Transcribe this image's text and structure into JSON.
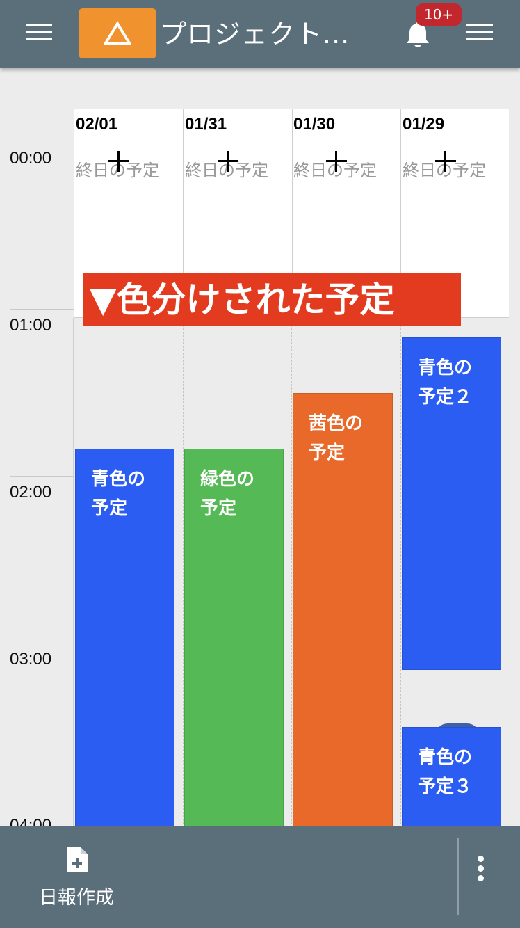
{
  "header": {
    "title": "プロジェクト...",
    "notification_badge": "10+",
    "colors": {
      "bar": "#5b6f7b",
      "logo": "#f0922d",
      "badge": "#c1272d"
    }
  },
  "calendar": {
    "all_day_label": "終日の予定",
    "days": [
      {
        "date": "02/01"
      },
      {
        "date": "01/31"
      },
      {
        "date": "01/30"
      },
      {
        "date": "01/29"
      }
    ],
    "hours": [
      "00:00",
      "01:00",
      "02:00",
      "03:00",
      "04:00"
    ],
    "overlay_label": "▼色分けされた予定",
    "events": [
      {
        "title_line1": "青色の",
        "title_line2": "予定",
        "color": "#2b5df3"
      },
      {
        "title_line1": "緑色の",
        "title_line2": "予定",
        "color": "#55b955"
      },
      {
        "title_line1": "茜色の",
        "title_line2": "予定",
        "color": "#e8692a"
      },
      {
        "title_line1": "青色の",
        "title_line2": "予定２",
        "color": "#2b5df3"
      },
      {
        "title_line1": "青色の",
        "title_line2": "予定３",
        "color": "#2b5df3"
      }
    ]
  },
  "footer": {
    "daily_report_label": "日報作成",
    "icons": [
      "document-add-icon",
      "more-vertical-icon"
    ]
  }
}
